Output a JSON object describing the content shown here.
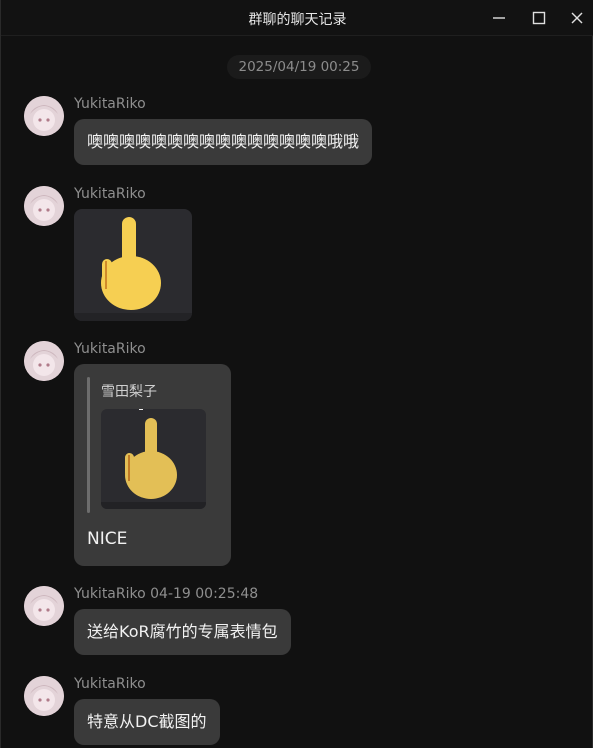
{
  "window": {
    "title": "群聊的聊天记录"
  },
  "divider": {
    "date": "2025/04/19 00:25"
  },
  "messages": [
    {
      "sender": "YukitaRiko",
      "text": "噢噢噢噢噢噢噢噢噢噢噢噢噢噢噢哦哦"
    },
    {
      "sender": "YukitaRiko",
      "image": "middle-finger-emoji"
    },
    {
      "sender": "YukitaRiko",
      "quote": {
        "author": "雪田梨子",
        "image": "middle-finger-emoji"
      },
      "text": "NICE"
    },
    {
      "sender": "YukitaRiko 04-19 00:25:48",
      "text": "送给KoR腐竹的专属表情包"
    },
    {
      "sender": "YukitaRiko",
      "text": "特意从DC截图的"
    }
  ],
  "colors": {
    "background": "#111111",
    "bubble": "#3a3a3a",
    "emoji": "#f6cf52"
  }
}
